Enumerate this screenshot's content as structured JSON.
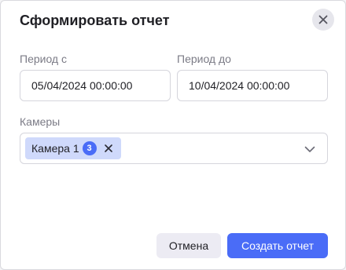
{
  "dialog": {
    "title": "Сформировать отчет"
  },
  "period_from": {
    "label": "Период с",
    "value": "05/04/2024 00:00:00"
  },
  "period_to": {
    "label": "Период до",
    "value": "10/04/2024 00:00:00"
  },
  "cameras": {
    "label": "Камеры",
    "chips": [
      {
        "label": "Камера 1",
        "count": "3"
      }
    ]
  },
  "footer": {
    "cancel_label": "Отмена",
    "create_label": "Создать отчет"
  },
  "icons": {
    "close": "close-icon",
    "chip_remove": "close-icon",
    "dropdown": "chevron-down-icon"
  },
  "colors": {
    "accent": "#4a6cf7",
    "chip_background": "#cfd9fb",
    "cancel_background": "#ecebf3"
  }
}
